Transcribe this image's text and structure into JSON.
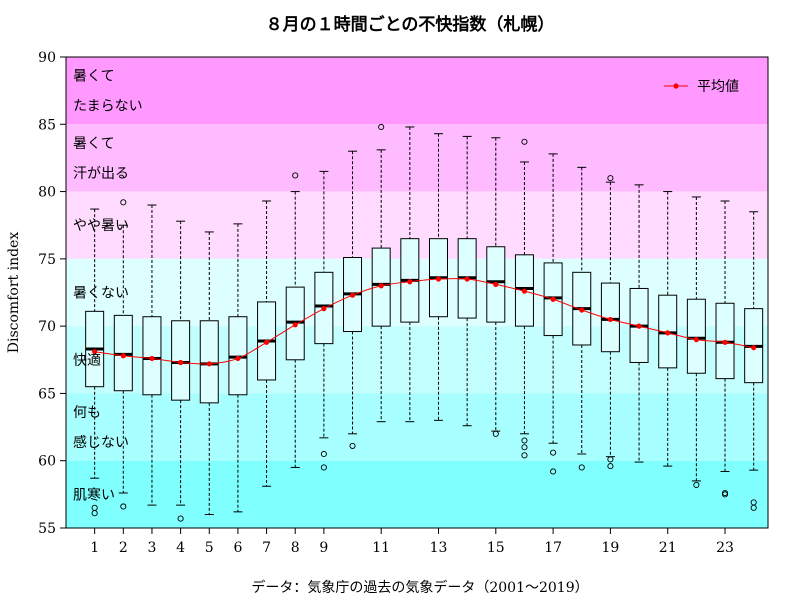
{
  "chart_data": {
    "type": "box",
    "title": "８月の１時間ごとの不快指数（札幌）",
    "ylabel": "Discomfort index",
    "xlabel": "",
    "source": "データ：気象庁の過去の気象データ（2001〜2019）",
    "ylim": [
      55,
      90
    ],
    "xlim": [
      0,
      24.5
    ],
    "y_ticks": [
      55,
      60,
      65,
      70,
      75,
      80,
      85,
      90
    ],
    "x_ticks": [
      1,
      2,
      3,
      4,
      5,
      6,
      7,
      8,
      9,
      11,
      13,
      15,
      17,
      19,
      21,
      23
    ],
    "legend": {
      "label": "平均値",
      "position": "top-right"
    },
    "bands": [
      {
        "from": 85,
        "to": 90,
        "color": "#ff99ff",
        "label_lines": [
          "暑くて",
          "たまらない"
        ]
      },
      {
        "from": 80,
        "to": 85,
        "color": "#ffbbff",
        "label_lines": [
          "暑くて",
          "汗が出る"
        ]
      },
      {
        "from": 75,
        "to": 80,
        "color": "#ffdcff",
        "label_lines": [
          "やや暑い"
        ]
      },
      {
        "from": 70,
        "to": 75,
        "color": "#ddffff",
        "label_lines": [
          "暑くない"
        ]
      },
      {
        "from": 65,
        "to": 70,
        "color": "#c4ffff",
        "label_lines": [
          "快適"
        ]
      },
      {
        "from": 60,
        "to": 65,
        "color": "#a8ffff",
        "label_lines": [
          "何も",
          "感じない"
        ]
      },
      {
        "from": 55,
        "to": 60,
        "color": "#80ffff",
        "label_lines": [
          "肌寒い"
        ]
      }
    ],
    "box_fill": "#ddffff",
    "mean_color": "#ff0000",
    "boxes": [
      {
        "x": 1,
        "whisker_low": 58.7,
        "q1": 65.5,
        "median": 68.3,
        "q3": 71.1,
        "whisker_high": 78.7,
        "mean": 68.1,
        "outliers": [
          56.5,
          56.1
        ]
      },
      {
        "x": 2,
        "whisker_low": 57.6,
        "q1": 65.2,
        "median": 67.9,
        "q3": 70.8,
        "whisker_high": 77.5,
        "mean": 67.8,
        "outliers": [
          56.6,
          79.2
        ]
      },
      {
        "x": 3,
        "whisker_low": 56.7,
        "q1": 64.9,
        "median": 67.6,
        "q3": 70.7,
        "whisker_high": 79.0,
        "mean": 67.6,
        "outliers": []
      },
      {
        "x": 4,
        "whisker_low": 56.7,
        "q1": 64.5,
        "median": 67.3,
        "q3": 70.4,
        "whisker_high": 77.8,
        "mean": 67.3,
        "outliers": [
          55.7
        ]
      },
      {
        "x": 5,
        "whisker_low": 56.0,
        "q1": 64.3,
        "median": 67.2,
        "q3": 70.4,
        "whisker_high": 77.0,
        "mean": 67.2,
        "outliers": []
      },
      {
        "x": 6,
        "whisker_low": 56.2,
        "q1": 64.9,
        "median": 67.7,
        "q3": 70.7,
        "whisker_high": 77.6,
        "mean": 67.6,
        "outliers": []
      },
      {
        "x": 7,
        "whisker_low": 58.1,
        "q1": 66.0,
        "median": 68.9,
        "q3": 71.8,
        "whisker_high": 79.3,
        "mean": 68.8,
        "outliers": []
      },
      {
        "x": 8,
        "whisker_low": 59.5,
        "q1": 67.5,
        "median": 70.3,
        "q3": 72.9,
        "whisker_high": 80.0,
        "mean": 70.1,
        "outliers": [
          81.2
        ]
      },
      {
        "x": 9,
        "whisker_low": 61.7,
        "q1": 68.7,
        "median": 71.5,
        "q3": 74.0,
        "whisker_high": 81.5,
        "mean": 71.3,
        "outliers": [
          60.5,
          59.5
        ]
      },
      {
        "x": 10,
        "whisker_low": 62.0,
        "q1": 69.6,
        "median": 72.4,
        "q3": 75.1,
        "whisker_high": 83.0,
        "mean": 72.3,
        "outliers": [
          61.1
        ]
      },
      {
        "x": 11,
        "whisker_low": 62.9,
        "q1": 70.0,
        "median": 73.1,
        "q3": 75.8,
        "whisker_high": 83.1,
        "mean": 73.0,
        "outliers": [
          84.8
        ]
      },
      {
        "x": 12,
        "whisker_low": 62.9,
        "q1": 70.3,
        "median": 73.4,
        "q3": 76.5,
        "whisker_high": 84.8,
        "mean": 73.3,
        "outliers": []
      },
      {
        "x": 13,
        "whisker_low": 63.0,
        "q1": 70.7,
        "median": 73.6,
        "q3": 76.5,
        "whisker_high": 84.3,
        "mean": 73.5,
        "outliers": []
      },
      {
        "x": 14,
        "whisker_low": 62.6,
        "q1": 70.6,
        "median": 73.6,
        "q3": 76.5,
        "whisker_high": 84.1,
        "mean": 73.5,
        "outliers": []
      },
      {
        "x": 15,
        "whisker_low": 62.2,
        "q1": 70.3,
        "median": 73.3,
        "q3": 75.9,
        "whisker_high": 84.0,
        "mean": 73.1,
        "outliers": [
          62.0
        ]
      },
      {
        "x": 16,
        "whisker_low": 62.0,
        "q1": 70.0,
        "median": 72.8,
        "q3": 75.3,
        "whisker_high": 82.2,
        "mean": 72.6,
        "outliers": [
          83.7,
          61.5,
          61.0,
          60.4
        ]
      },
      {
        "x": 17,
        "whisker_low": 61.3,
        "q1": 69.3,
        "median": 72.1,
        "q3": 74.7,
        "whisker_high": 82.8,
        "mean": 72.0,
        "outliers": [
          60.6,
          59.2
        ]
      },
      {
        "x": 18,
        "whisker_low": 60.5,
        "q1": 68.6,
        "median": 71.3,
        "q3": 74.0,
        "whisker_high": 81.8,
        "mean": 71.2,
        "outliers": [
          59.5
        ]
      },
      {
        "x": 19,
        "whisker_low": 60.3,
        "q1": 68.1,
        "median": 70.5,
        "q3": 73.2,
        "whisker_high": 80.7,
        "mean": 70.5,
        "outliers": [
          81.0,
          60.1,
          59.6
        ]
      },
      {
        "x": 20,
        "whisker_low": 59.9,
        "q1": 67.3,
        "median": 70.0,
        "q3": 72.8,
        "whisker_high": 80.5,
        "mean": 70.0,
        "outliers": []
      },
      {
        "x": 21,
        "whisker_low": 59.6,
        "q1": 66.9,
        "median": 69.5,
        "q3": 72.3,
        "whisker_high": 80.0,
        "mean": 69.5,
        "outliers": []
      },
      {
        "x": 22,
        "whisker_low": 58.5,
        "q1": 66.5,
        "median": 69.1,
        "q3": 72.0,
        "whisker_high": 79.6,
        "mean": 69.0,
        "outliers": [
          58.2
        ]
      },
      {
        "x": 23,
        "whisker_low": 59.2,
        "q1": 66.1,
        "median": 68.8,
        "q3": 71.7,
        "whisker_high": 79.3,
        "mean": 68.8,
        "outliers": [
          57.6,
          57.5
        ]
      },
      {
        "x": 24,
        "whisker_low": 59.3,
        "q1": 65.8,
        "median": 68.5,
        "q3": 71.3,
        "whisker_high": 78.5,
        "mean": 68.4,
        "outliers": [
          56.9,
          56.5
        ]
      }
    ]
  }
}
